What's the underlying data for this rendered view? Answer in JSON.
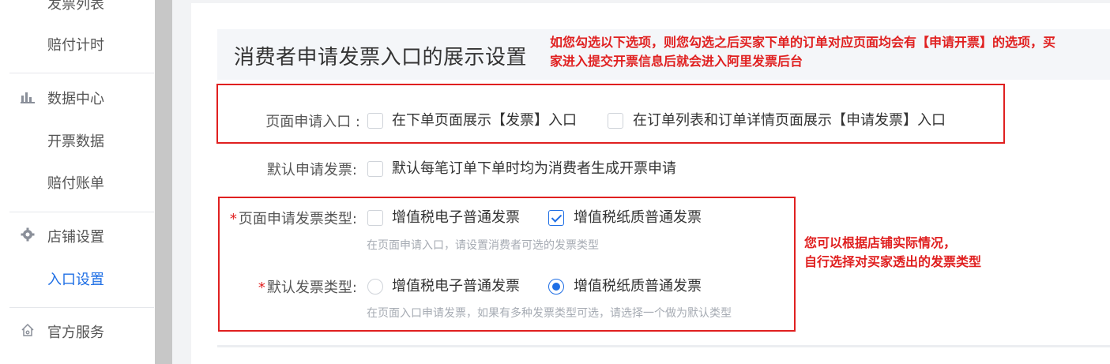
{
  "sidebar": {
    "items": [
      {
        "label": "发票列表",
        "type": "sub"
      },
      {
        "label": "赔付计时",
        "type": "sub"
      },
      {
        "label": "数据中心",
        "type": "group",
        "icon": "bar-chart-icon"
      },
      {
        "label": "开票数据",
        "type": "sub"
      },
      {
        "label": "赔付账单",
        "type": "sub"
      },
      {
        "label": "店铺设置",
        "type": "group",
        "icon": "gear-icon"
      },
      {
        "label": "入口设置",
        "type": "sub",
        "active": true
      },
      {
        "label": "官方服务",
        "type": "group",
        "icon": "home-icon"
      }
    ]
  },
  "main": {
    "title": "消费者申请发票入口的展示设置",
    "annotation_top": "如您勾选以下选项，则您勾选之后买家下单的订单对应页面均会有【申请开票】的选项，买家进入提交开票信息后就会进入阿里发票后台",
    "annotation_side_line1": "您可以根据店铺实际情况，",
    "annotation_side_line2": "自行选择对买家透出的发票类型",
    "rows": {
      "entry": {
        "label": "页面申请入口 :",
        "options": [
          {
            "label": "在下单页面展示【发票】入口",
            "checked": false
          },
          {
            "label": "在订单列表和订单详情页面展示【申请发票】入口",
            "checked": false
          }
        ]
      },
      "default_apply": {
        "label": "默认申请发票:",
        "options": [
          {
            "label": "默认每笔订单下单时均为消费者生成开票申请",
            "checked": false
          }
        ]
      },
      "invoice_types": {
        "required": "*",
        "label": "页面申请发票类型:",
        "options": [
          {
            "label": "增值税电子普通发票",
            "checked": false
          },
          {
            "label": "增值税纸质普通发票",
            "checked": true
          }
        ],
        "hint": "在页面申请入口，请设置消费者可选的发票类型"
      },
      "default_type": {
        "required": "*",
        "label": "默认发票类型:",
        "options": [
          {
            "label": "增值税电子普通发票",
            "selected": false
          },
          {
            "label": "增值税纸质普通发票",
            "selected": true
          }
        ],
        "hint": "在页面入口申请发票，如果有多种发票类型可选，请选择一个做为默认类型"
      }
    }
  },
  "colors": {
    "accent": "#1f6fe5",
    "annotation_red": "#e02020"
  }
}
